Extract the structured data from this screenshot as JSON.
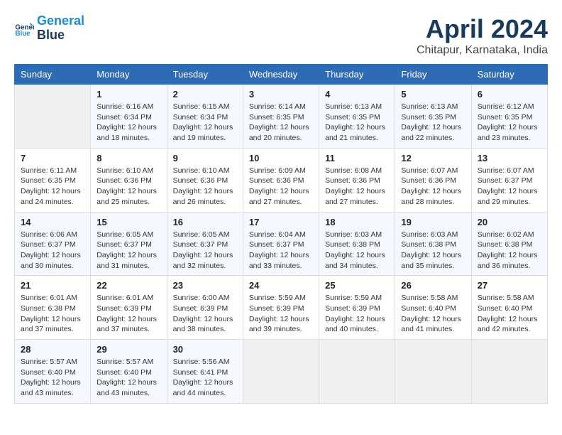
{
  "logo": {
    "line1": "General",
    "line2": "Blue"
  },
  "title": "April 2024",
  "subtitle": "Chitapur, Karnataka, India",
  "header_days": [
    "Sunday",
    "Monday",
    "Tuesday",
    "Wednesday",
    "Thursday",
    "Friday",
    "Saturday"
  ],
  "weeks": [
    [
      {
        "day": "",
        "info": ""
      },
      {
        "day": "1",
        "info": "Sunrise: 6:16 AM\nSunset: 6:34 PM\nDaylight: 12 hours\nand 18 minutes."
      },
      {
        "day": "2",
        "info": "Sunrise: 6:15 AM\nSunset: 6:34 PM\nDaylight: 12 hours\nand 19 minutes."
      },
      {
        "day": "3",
        "info": "Sunrise: 6:14 AM\nSunset: 6:35 PM\nDaylight: 12 hours\nand 20 minutes."
      },
      {
        "day": "4",
        "info": "Sunrise: 6:13 AM\nSunset: 6:35 PM\nDaylight: 12 hours\nand 21 minutes."
      },
      {
        "day": "5",
        "info": "Sunrise: 6:13 AM\nSunset: 6:35 PM\nDaylight: 12 hours\nand 22 minutes."
      },
      {
        "day": "6",
        "info": "Sunrise: 6:12 AM\nSunset: 6:35 PM\nDaylight: 12 hours\nand 23 minutes."
      }
    ],
    [
      {
        "day": "7",
        "info": "Sunrise: 6:11 AM\nSunset: 6:35 PM\nDaylight: 12 hours\nand 24 minutes."
      },
      {
        "day": "8",
        "info": "Sunrise: 6:10 AM\nSunset: 6:36 PM\nDaylight: 12 hours\nand 25 minutes."
      },
      {
        "day": "9",
        "info": "Sunrise: 6:10 AM\nSunset: 6:36 PM\nDaylight: 12 hours\nand 26 minutes."
      },
      {
        "day": "10",
        "info": "Sunrise: 6:09 AM\nSunset: 6:36 PM\nDaylight: 12 hours\nand 27 minutes."
      },
      {
        "day": "11",
        "info": "Sunrise: 6:08 AM\nSunset: 6:36 PM\nDaylight: 12 hours\nand 27 minutes."
      },
      {
        "day": "12",
        "info": "Sunrise: 6:07 AM\nSunset: 6:36 PM\nDaylight: 12 hours\nand 28 minutes."
      },
      {
        "day": "13",
        "info": "Sunrise: 6:07 AM\nSunset: 6:37 PM\nDaylight: 12 hours\nand 29 minutes."
      }
    ],
    [
      {
        "day": "14",
        "info": "Sunrise: 6:06 AM\nSunset: 6:37 PM\nDaylight: 12 hours\nand 30 minutes."
      },
      {
        "day": "15",
        "info": "Sunrise: 6:05 AM\nSunset: 6:37 PM\nDaylight: 12 hours\nand 31 minutes."
      },
      {
        "day": "16",
        "info": "Sunrise: 6:05 AM\nSunset: 6:37 PM\nDaylight: 12 hours\nand 32 minutes."
      },
      {
        "day": "17",
        "info": "Sunrise: 6:04 AM\nSunset: 6:37 PM\nDaylight: 12 hours\nand 33 minutes."
      },
      {
        "day": "18",
        "info": "Sunrise: 6:03 AM\nSunset: 6:38 PM\nDaylight: 12 hours\nand 34 minutes."
      },
      {
        "day": "19",
        "info": "Sunrise: 6:03 AM\nSunset: 6:38 PM\nDaylight: 12 hours\nand 35 minutes."
      },
      {
        "day": "20",
        "info": "Sunrise: 6:02 AM\nSunset: 6:38 PM\nDaylight: 12 hours\nand 36 minutes."
      }
    ],
    [
      {
        "day": "21",
        "info": "Sunrise: 6:01 AM\nSunset: 6:38 PM\nDaylight: 12 hours\nand 37 minutes."
      },
      {
        "day": "22",
        "info": "Sunrise: 6:01 AM\nSunset: 6:39 PM\nDaylight: 12 hours\nand 37 minutes."
      },
      {
        "day": "23",
        "info": "Sunrise: 6:00 AM\nSunset: 6:39 PM\nDaylight: 12 hours\nand 38 minutes."
      },
      {
        "day": "24",
        "info": "Sunrise: 5:59 AM\nSunset: 6:39 PM\nDaylight: 12 hours\nand 39 minutes."
      },
      {
        "day": "25",
        "info": "Sunrise: 5:59 AM\nSunset: 6:39 PM\nDaylight: 12 hours\nand 40 minutes."
      },
      {
        "day": "26",
        "info": "Sunrise: 5:58 AM\nSunset: 6:40 PM\nDaylight: 12 hours\nand 41 minutes."
      },
      {
        "day": "27",
        "info": "Sunrise: 5:58 AM\nSunset: 6:40 PM\nDaylight: 12 hours\nand 42 minutes."
      }
    ],
    [
      {
        "day": "28",
        "info": "Sunrise: 5:57 AM\nSunset: 6:40 PM\nDaylight: 12 hours\nand 43 minutes."
      },
      {
        "day": "29",
        "info": "Sunrise: 5:57 AM\nSunset: 6:40 PM\nDaylight: 12 hours\nand 43 minutes."
      },
      {
        "day": "30",
        "info": "Sunrise: 5:56 AM\nSunset: 6:41 PM\nDaylight: 12 hours\nand 44 minutes."
      },
      {
        "day": "",
        "info": ""
      },
      {
        "day": "",
        "info": ""
      },
      {
        "day": "",
        "info": ""
      },
      {
        "day": "",
        "info": ""
      }
    ]
  ]
}
